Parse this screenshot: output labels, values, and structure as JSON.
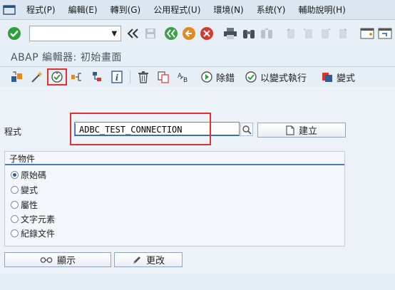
{
  "menu": {
    "items": [
      "程式(P)",
      "編輯(E)",
      "轉到(G)",
      "公用程式(U)",
      "環境(N)",
      "系统(Y)",
      "輔助說明(H)"
    ]
  },
  "systoolbar": {
    "command_value": "",
    "command_placeholder": ""
  },
  "title": "ABAP 編輯器: 初始畫面",
  "apptoolbar": {
    "debug_label": "除錯",
    "execute_variant_label": "以變式執行",
    "variant_label": "變式"
  },
  "form": {
    "program_label": "程式",
    "program_value": "ADBC_TEST_CONNECTION",
    "create_label": "建立"
  },
  "subobjects": {
    "title": "子物件",
    "options": [
      "原始碼",
      "變式",
      "屬性",
      "文字元素",
      "紀錄文件"
    ],
    "selected_index": 0
  },
  "buttons": {
    "display_label": "顯示",
    "change_label": "更改"
  },
  "colors": {
    "highlight": "#e0322d",
    "accent_blue": "#4a7ab3",
    "ok_green": "#2f9e3b",
    "cancel_red": "#d33b2f",
    "nav_green": "#3aa04a"
  }
}
